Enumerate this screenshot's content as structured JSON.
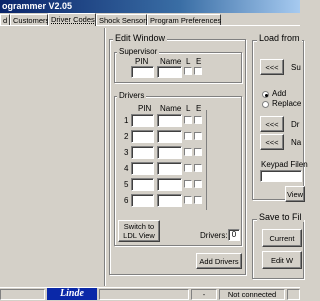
{
  "window": {
    "title": "ogrammer V2.05"
  },
  "tabs": [
    {
      "label": "d"
    },
    {
      "label": "Customers"
    },
    {
      "label": "Driver Codes"
    },
    {
      "label": "Shock Sensors"
    },
    {
      "label": "Program Preferences"
    }
  ],
  "edit_window": {
    "title": "Edit Window",
    "supervisor": {
      "title": "Supervisor",
      "pin_label": "PIN",
      "name_label": "Name",
      "l_label": "L",
      "e_label": "E"
    },
    "drivers": {
      "title": "Drivers",
      "pin_label": "PIN",
      "name_label": "Name",
      "l_label": "L",
      "e_label": "E",
      "rows": [
        {
          "num": "1"
        },
        {
          "num": "2"
        },
        {
          "num": "3"
        },
        {
          "num": "4"
        },
        {
          "num": "5"
        },
        {
          "num": "6"
        }
      ],
      "switch_button": "Switch to LDL View",
      "count_label": "Drivers:",
      "count_value": "0"
    },
    "add_drivers_button": "Add Drivers"
  },
  "load_from": {
    "title": "Load from",
    "first_button": "<<<",
    "first_label": "Su",
    "radio_add": "Add",
    "radio_replace": "Replace",
    "button2": "<<<",
    "button2_label": "Dr",
    "button3": "<<<",
    "button3_label": "Na",
    "keypad_label": "Keypad Filen",
    "view_button": "View"
  },
  "save_to": {
    "title": "Save to Fil",
    "current_button": "Current",
    "edit_button": "Edit W"
  },
  "status": {
    "logo": "Linde",
    "dash": "-",
    "connection": "Not connected"
  },
  "colors": {
    "face": "#d4d0c8",
    "titlebar": "#0a246a",
    "logo_bg": "#0a28a8"
  }
}
